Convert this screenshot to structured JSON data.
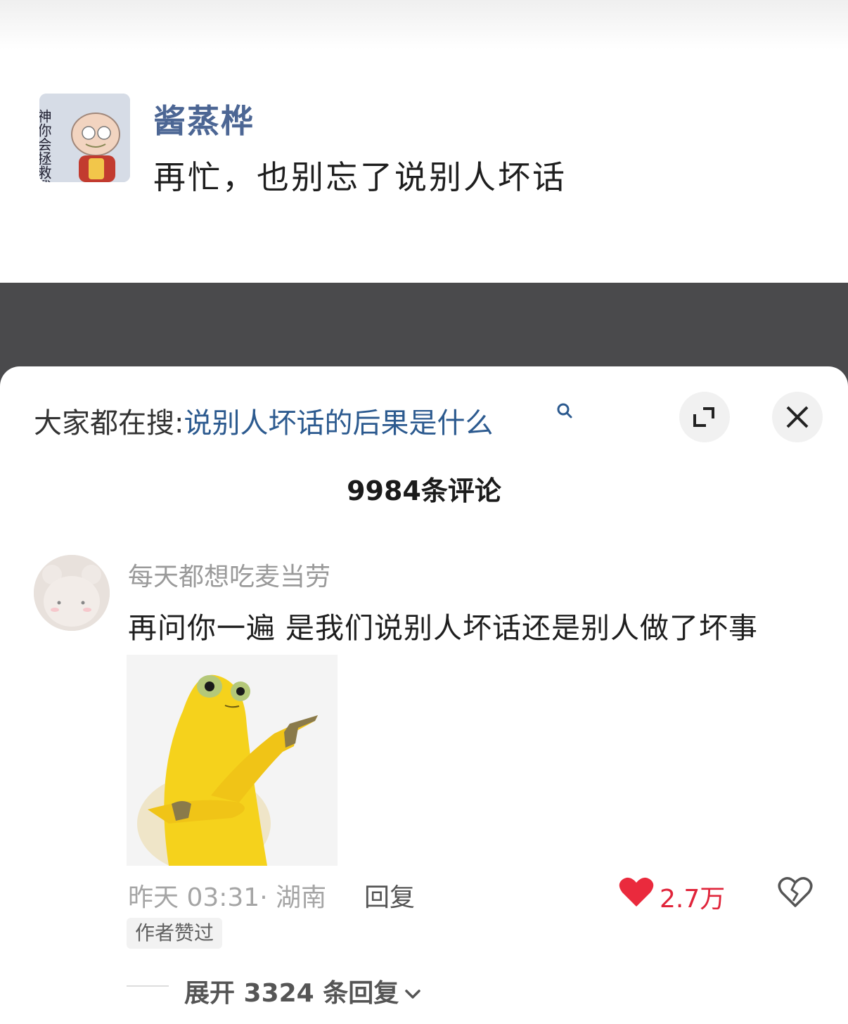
{
  "post": {
    "author": "酱蒸桦",
    "text": "再忙，也别忘了说别人坏话",
    "avatar_icon": "cartoon-avatar-icon",
    "avatar_text": "神你会拯救我吗"
  },
  "sheet": {
    "search_prefix": "大家都在搜:",
    "search_query": "说别人坏话的后果是什么",
    "search_icon": "search-icon",
    "expand_icon": "expand-icon",
    "close_icon": "close-icon",
    "comment_count_label": "9984条评论"
  },
  "comment": {
    "user": "每天都想吃麦当劳",
    "text": "再问你一遍 是我们说别人坏话还是别人做了坏事",
    "sticker_icon": "yellow-creature-pointing-sticker",
    "time_location": "昨天 03:31· 湖南",
    "reply_label": "回复",
    "like_count": "2.7万",
    "like_icon": "heart-filled-icon",
    "dislike_icon": "broken-heart-icon",
    "author_badge": "作者赞过",
    "expand_replies": "展开 3324 条回复"
  },
  "colors": {
    "accent_blue": "#2c5a8f",
    "author_blue": "#4c6694",
    "like_red": "#e0243a",
    "dark_band": "#4a4a4c"
  }
}
